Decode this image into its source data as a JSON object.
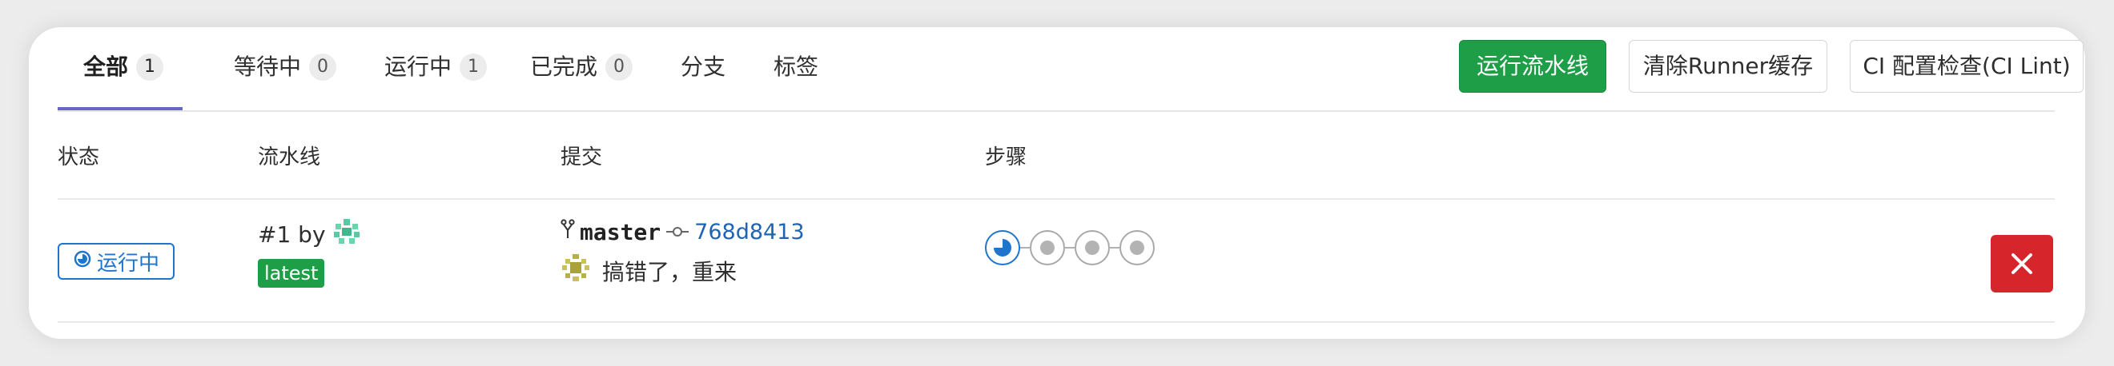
{
  "tabs": [
    {
      "label": "全部",
      "count": "1",
      "active": true
    },
    {
      "label": "等待中",
      "count": "0"
    },
    {
      "label": "运行中",
      "count": "1"
    },
    {
      "label": "已完成",
      "count": "0"
    },
    {
      "label": "分支"
    },
    {
      "label": "标签"
    }
  ],
  "actions": {
    "run_pipeline": "运行流水线",
    "clear_runner_cache": "清除Runner缓存",
    "ci_lint": "CI 配置检查(CI Lint)"
  },
  "table": {
    "headers": [
      "状态",
      "流水线",
      "提交",
      "步骤"
    ]
  },
  "pipelines": [
    {
      "status": "运行中",
      "id_text": "#1 by",
      "tag": "latest",
      "branch": "master",
      "sha": "768d8413",
      "message": "搞错了，重来",
      "stages": [
        "running",
        "pending",
        "pending",
        "pending"
      ],
      "cancel_icon": "close-icon"
    }
  ],
  "colors": {
    "primary": "#1f9e48",
    "running": "#1f75cb",
    "danger": "#d7262b",
    "tab_active": "#6666c4"
  }
}
